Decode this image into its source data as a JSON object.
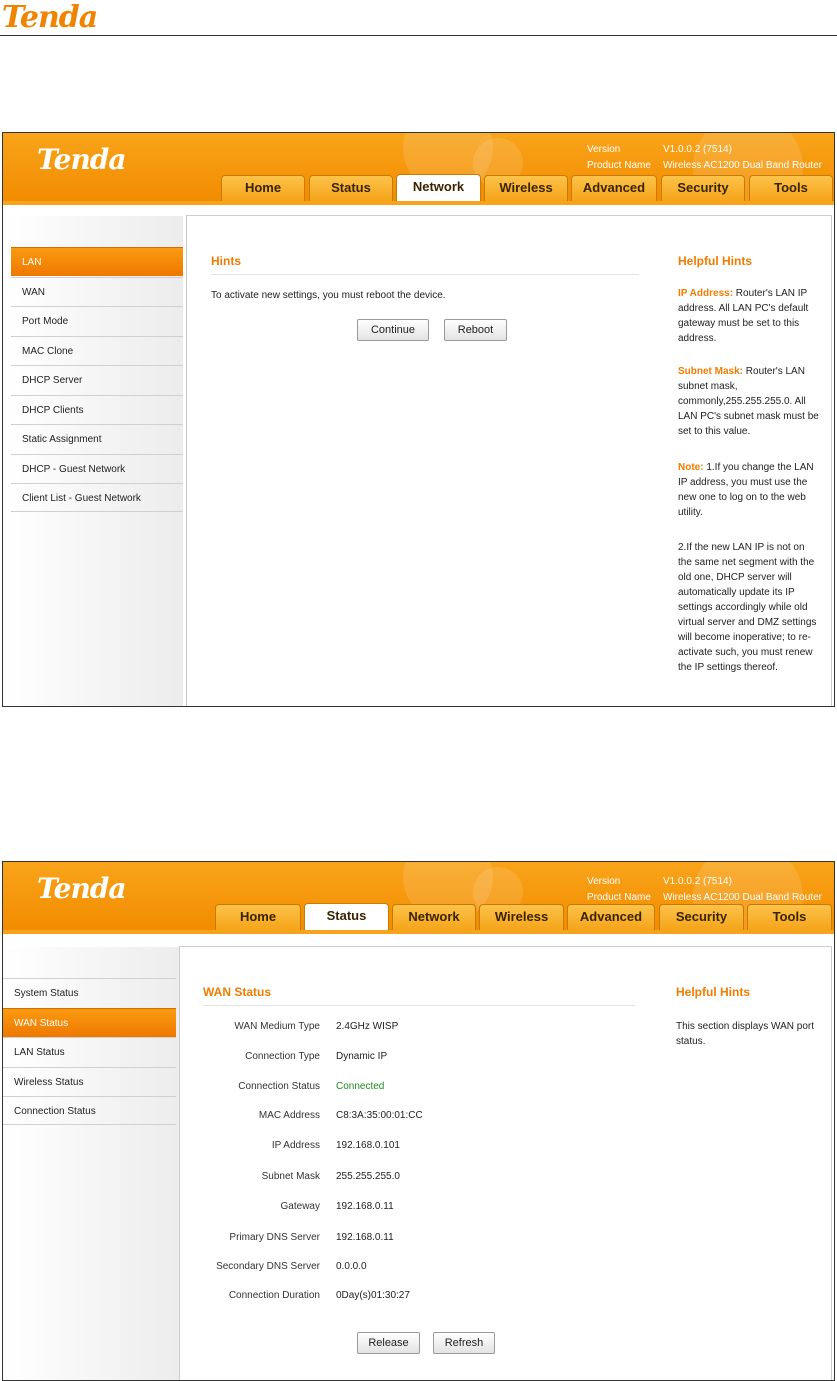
{
  "doc": {
    "logo": "Tenda"
  },
  "screen1": {
    "brand": "Tenda",
    "version_label": "Version",
    "version_value": "V1.0.0.2 (7514)",
    "product_label": "Product Name",
    "product_value": "Wireless AC1200 Dual Band Router",
    "tabs": [
      "Home",
      "Status",
      "Network",
      "Wireless",
      "Advanced",
      "Security",
      "Tools"
    ],
    "active_tab": "Network",
    "menu": [
      "LAN",
      "WAN",
      "Port Mode",
      "MAC Clone",
      "DHCP Server",
      "DHCP Clients",
      "Static Assignment",
      "DHCP - Guest Network",
      "Client List - Guest Network"
    ],
    "active_menu": "LAN",
    "section_title": "Hints",
    "message": "To activate new settings, you must reboot the device.",
    "continue_label": "Continue",
    "reboot_label": "Reboot",
    "helpful_title": "Helpful Hints",
    "hint_ip_key": "IP Address:",
    "hint_ip_text": " Router's LAN IP address. All LAN PC's default gateway must be set to this address.",
    "hint_mask_key": "Subnet Mask:",
    "hint_mask_text": " Router's LAN subnet mask, commonly,255.255.255.0. All LAN PC's subnet mask must be set to this value.",
    "hint_note_key": "Note:",
    "hint_note_text": " 1.If you change the LAN IP address, you must use the new one to log on to the web utility.",
    "hint_note2": "2.If the new LAN IP is not on the same net segment with the old one, DHCP server will automatically update its IP settings accordingly while old virtual server and DMZ settings will become inoperative; to re-activate such, you must renew the IP settings thereof."
  },
  "screen2": {
    "brand": "Tenda",
    "version_label": "Version",
    "version_value": "V1.0.0.2 (7514)",
    "product_label": "Product Name",
    "product_value": "Wireless AC1200 Dual Band Router",
    "tabs": [
      "Home",
      "Status",
      "Network",
      "Wireless",
      "Advanced",
      "Security",
      "Tools"
    ],
    "active_tab": "Status",
    "menu": [
      "System Status",
      "WAN Status",
      "LAN Status",
      "Wireless Status",
      "Connection Status"
    ],
    "active_menu": "WAN Status",
    "section_title": "WAN Status",
    "rows": [
      {
        "label": "WAN Medium Type",
        "value": "2.4GHz WISP"
      },
      {
        "label": "Connection Type",
        "value": "Dynamic IP"
      },
      {
        "label": "Connection Status",
        "value": "Connected"
      },
      {
        "label": "MAC Address",
        "value": "C8:3A:35:00:01:CC"
      },
      {
        "label": "IP Address",
        "value": "192.168.0.101"
      },
      {
        "label": "Subnet Mask",
        "value": "255.255.255.0"
      },
      {
        "label": "Gateway",
        "value": "192.168.0.11"
      },
      {
        "label": "Primary DNS Server",
        "value": "192.168.0.11"
      },
      {
        "label": "Secondary DNS Server",
        "value": "0.0.0.0"
      },
      {
        "label": "Connection Duration",
        "value": "0Day(s)01:30:27"
      }
    ],
    "connected_color": "#1e8a1e",
    "release_label": "Release",
    "refresh_label": "Refresh",
    "helpful_title": "Helpful Hints",
    "helpful_text": "This section displays WAN port status."
  },
  "colors": {
    "accent": "#f08300",
    "banner": "#f39a0c"
  }
}
